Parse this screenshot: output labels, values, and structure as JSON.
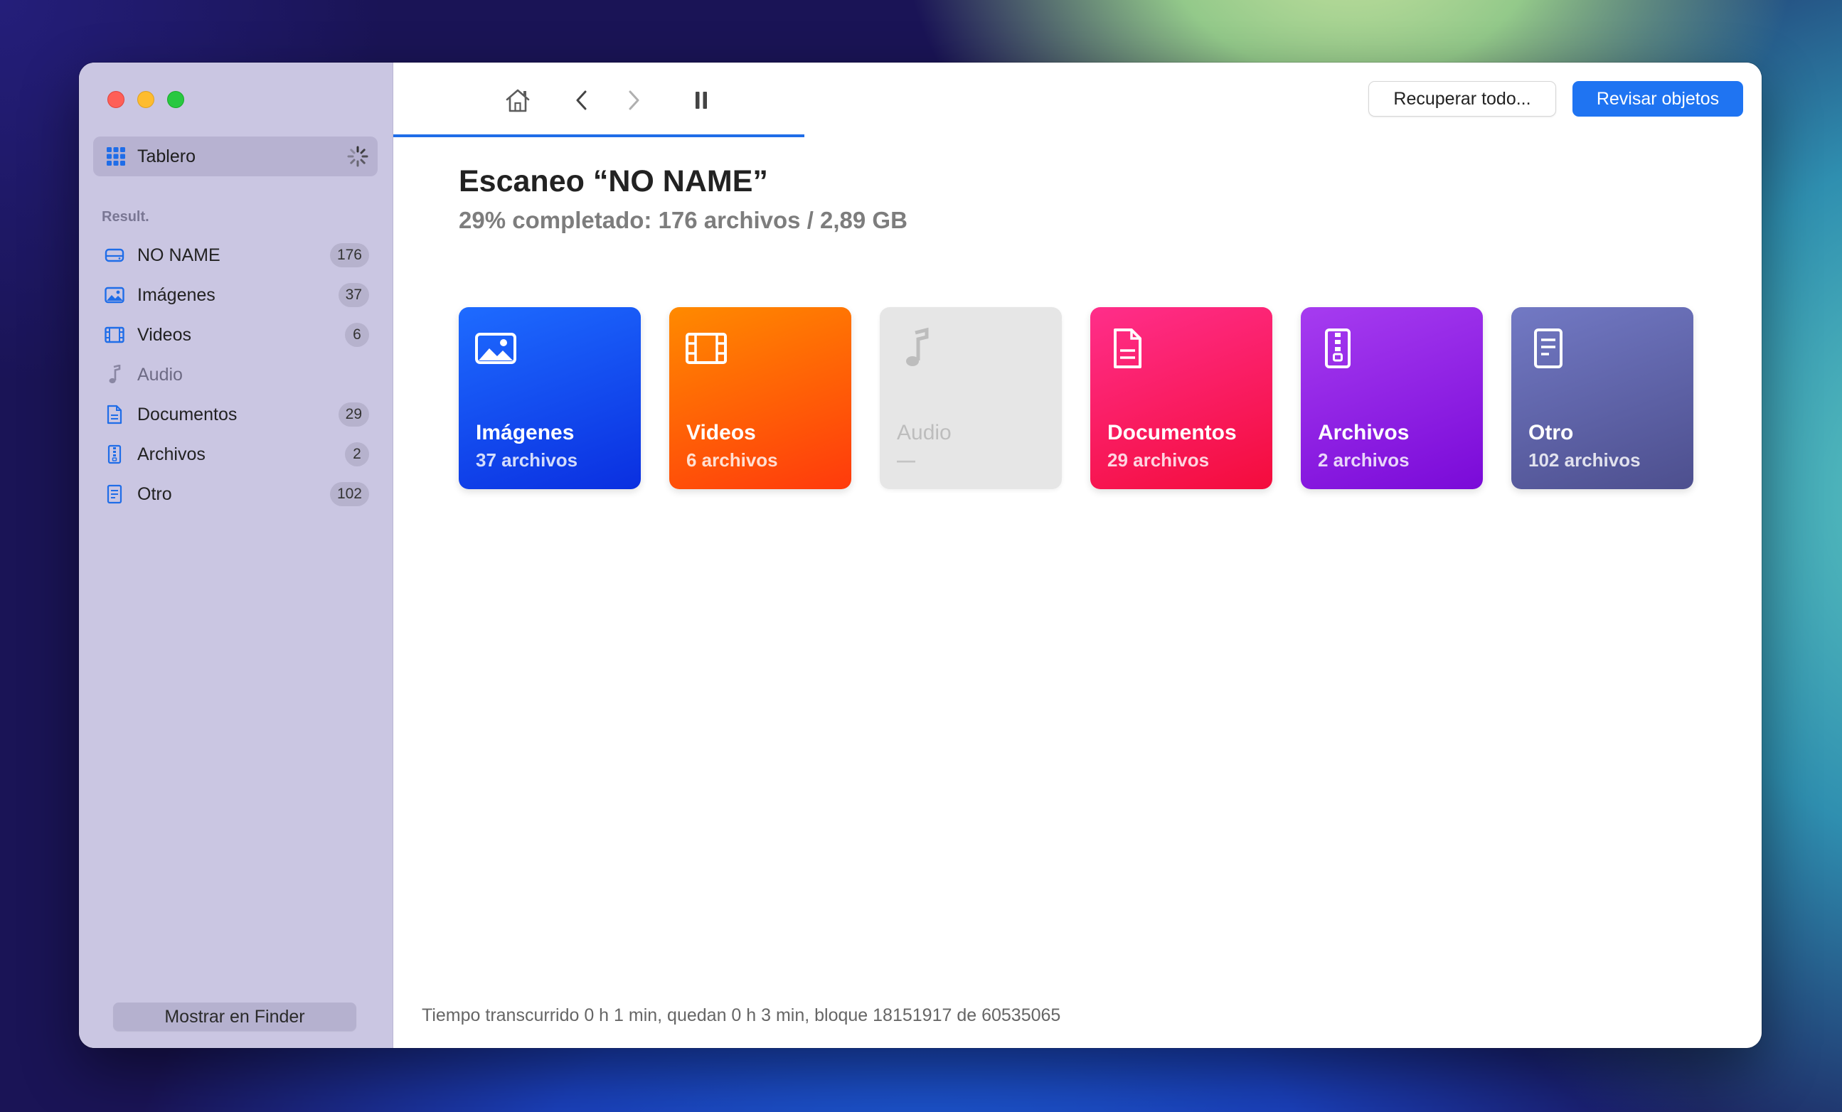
{
  "sidebar": {
    "dashboard_label": "Tablero",
    "section_title": "Result.",
    "items": [
      {
        "label": "NO NAME",
        "count": "176",
        "icon": "drive-icon"
      },
      {
        "label": "Imágenes",
        "count": "37",
        "icon": "image-icon"
      },
      {
        "label": "Videos",
        "count": "6",
        "icon": "film-icon"
      },
      {
        "label": "Audio",
        "count": "",
        "icon": "music-note-icon"
      },
      {
        "label": "Documentos",
        "count": "29",
        "icon": "document-icon"
      },
      {
        "label": "Archivos",
        "count": "2",
        "icon": "archive-icon"
      },
      {
        "label": "Otro",
        "count": "102",
        "icon": "other-file-icon"
      }
    ],
    "finder_button": "Mostrar en Finder"
  },
  "toolbar": {
    "recover_all": "Recuperar todo...",
    "review_items": "Revisar objetos",
    "icons": [
      "home-icon",
      "back-icon",
      "forward-icon",
      "pause-icon"
    ],
    "scan_progress": 0.29
  },
  "scan": {
    "title": "Escaneo “NO NAME”",
    "subtitle": "29% completado: 176 archivos / 2,89 GB"
  },
  "cards": [
    {
      "title": "Imágenes",
      "subtitle": "37 archivos",
      "color": "#1e5cff"
    },
    {
      "title": "Videos",
      "subtitle": "6 archivos",
      "color": "#ff6a00"
    },
    {
      "title": "Audio",
      "subtitle": "—",
      "color": "#e6e6e6"
    },
    {
      "title": "Documentos",
      "subtitle": "29 archivos",
      "color": "#fa1f60"
    },
    {
      "title": "Archivos",
      "subtitle": "2 archivos",
      "color": "#9022e6"
    },
    {
      "title": "Otro",
      "subtitle": "102 archivos",
      "color": "#5f64aa"
    }
  ],
  "status": "Tiempo transcurrido 0 h 1 min, quedan 0 h 3 min, bloque 18151917 de 60535065",
  "colors": {
    "accent": "#1f74f2",
    "sidebar_bg": "#cac6e2"
  }
}
